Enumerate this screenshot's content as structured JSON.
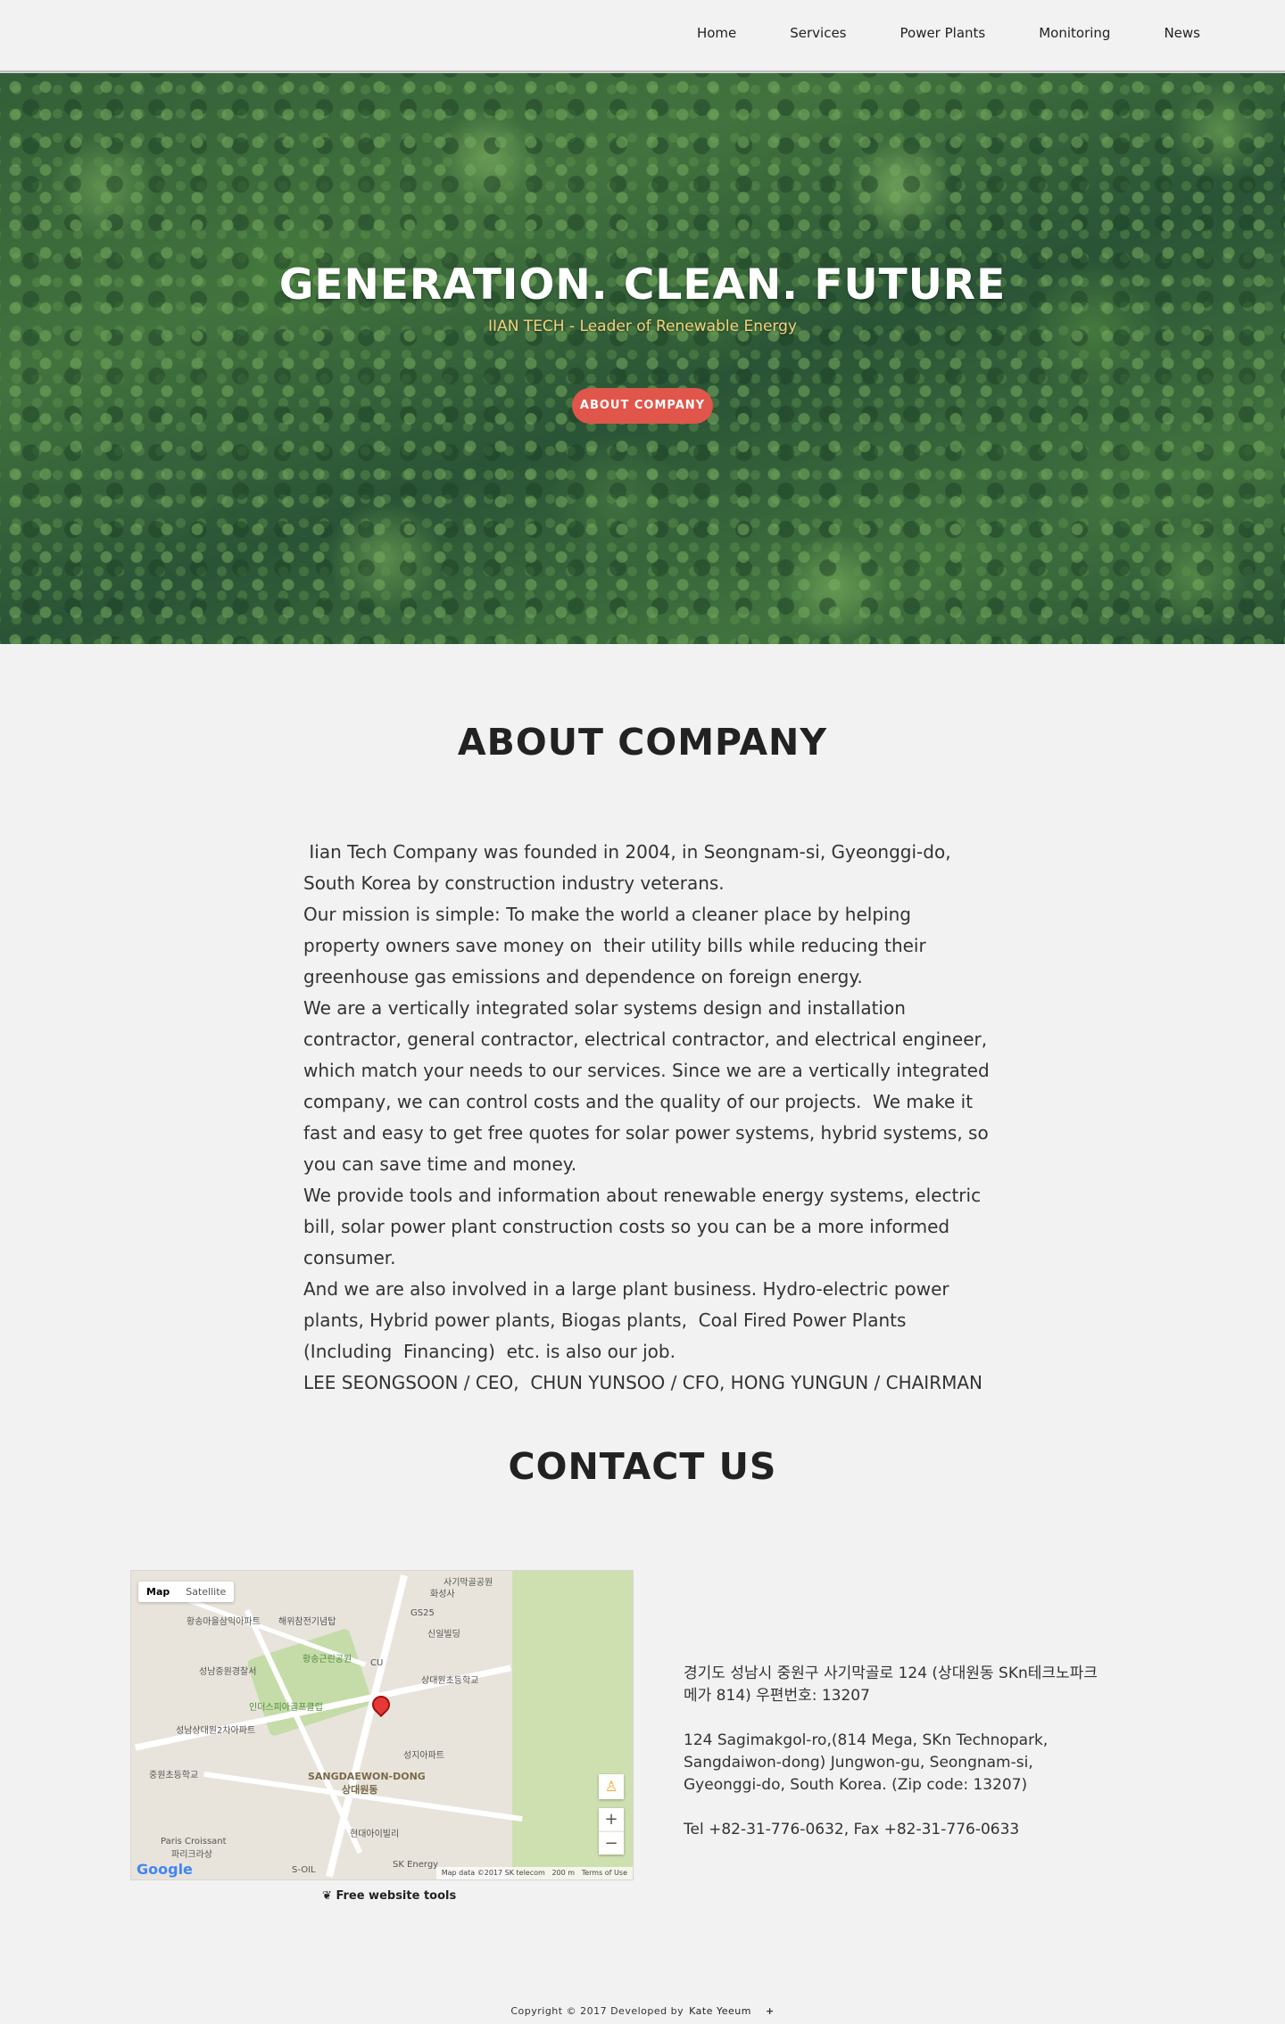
{
  "nav": {
    "items": [
      "Home",
      "Services",
      "Power Plants",
      "Monitoring",
      "News"
    ]
  },
  "hero": {
    "title": "GENERATION. CLEAN. FUTURE",
    "subtitle": "IIAN TECH - Leader of Renewable Energy",
    "button_label": "ABOUT COMPANY"
  },
  "about": {
    "title": "ABOUT COMPANY",
    "paragraphs": [
      " Iian Tech Company was founded in 2004, in Seongnam-si, Gyeonggi-do, South Korea by construction industry veterans.",
      "Our mission is simple: To make the world a cleaner place by helping property owners save money on  their utility bills while reducing their greenhouse gas emissions and dependence on foreign energy.",
      "We are a vertically integrated solar systems design and installation contractor, general contractor, electrical contractor, and electrical engineer, which match your needs to our services. Since we are a vertically integrated company, we can control costs and the quality of our projects.  We make it fast and easy to get free quotes for solar power systems, hybrid systems, so you can save time and money.",
      "We provide tools and information about renewable energy systems, electric bill, solar power plant construction costs so you can be a more informed consumer.",
      "And we are also involved in a large plant business. Hydro-electric power plants, Hybrid power plants, Biogas plants,  Coal Fired Power Plants (Including  Financing)  etc. is also our job.",
      "LEE SEONGSOON / CEO,  CHUN YUNSOO / CFO, HONG YUNGUN / CHAIRMAN"
    ]
  },
  "contact": {
    "title": "CONTACT US",
    "map": {
      "tab_map": "Map",
      "tab_satellite": "Satellite",
      "district": "SANGDAEWON-DONG",
      "district_ko": "상대원동",
      "labels": [
        "사기막골공원",
        "화성사",
        "황송마을삼익아파트",
        "해위참전기념탑",
        "GS25",
        "신일빌딩",
        "황송근린공원",
        "성남중원경찰서",
        "상대원초등학교",
        "인더스피아골프클럽",
        "성남상대원2차아파트",
        "성지아파트",
        "중원초등학교",
        "Paris Croissant",
        "파리크라상",
        "현대아이빌리",
        "S-OIL",
        "SK Energy",
        "CU"
      ],
      "logo": "Google",
      "attribution": "Map data ©2017 SK telecom",
      "scale": "200 m",
      "terms": "Terms of Use",
      "tools_link": "Free website tools"
    },
    "address_ko": "경기도 성남시 중원구 사기막골로 124 (상대원동 SKn테크노파크 메가 814) 우편번호: 13207",
    "address_en": "124 Sagimakgol-ro,(814 Mega, SKn Technopark, Sangdaiwon-dong) Jungwon-gu, Seongnam-si, Gyeonggi-do, South Korea. (Zip code: 13207)",
    "tel": "Tel +82-31-776-0632, Fax +82-31-776-0633"
  },
  "footer": {
    "copyright": "Copyright © 2017 Developed by",
    "author": "Kate Yeeum",
    "plus": "+"
  },
  "colors": {
    "accent_button": "#e0564a",
    "hero_subtitle": "#f5d27a",
    "background": "#f2f2f2"
  }
}
